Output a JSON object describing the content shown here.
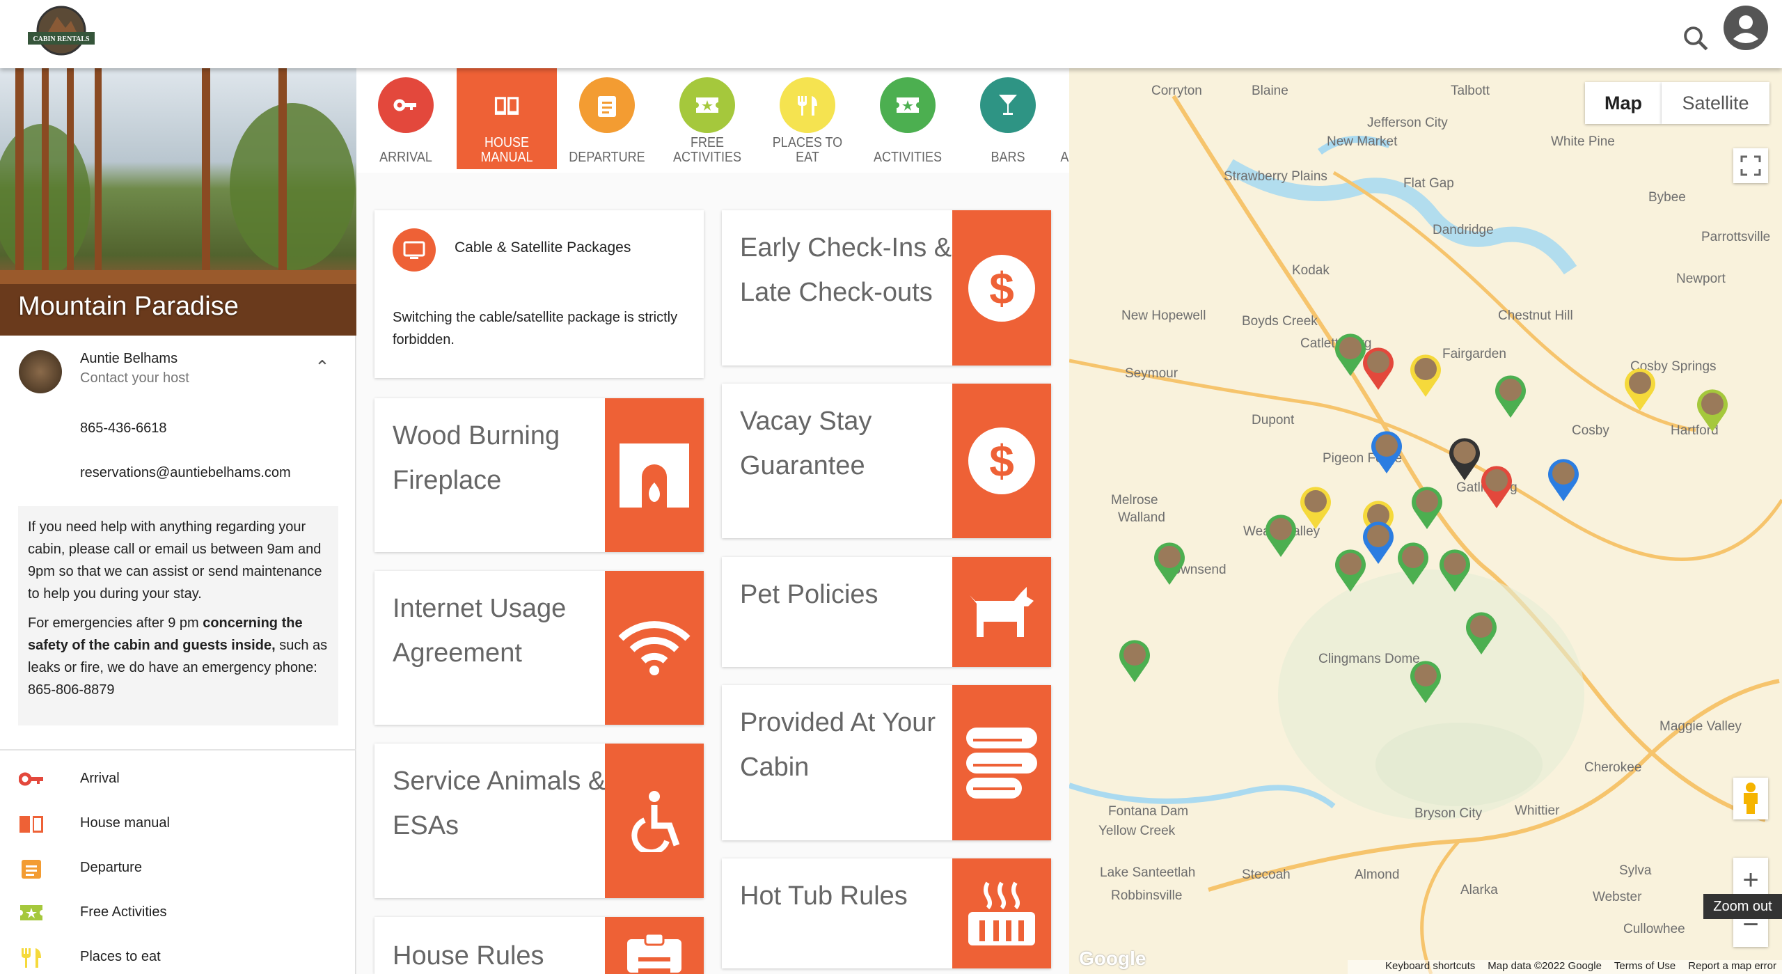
{
  "header": {
    "logo_text": "Auntie Belham's Cabin Rentals",
    "search_icon": "search-icon",
    "account_icon": "account-circle-icon"
  },
  "property": {
    "title": "Mountain Paradise"
  },
  "host": {
    "name": "Auntie Belhams",
    "subtitle": "Contact your host",
    "phone": "865-436-6618",
    "email": "reservations@auntiebelhams.com",
    "note_p1": "If you need help with anything regarding your cabin, please call or email us between 9am and 9pm so that we can assist or send maintenance to help you during your stay.",
    "note_p2_a": "For emergencies after 9 pm ",
    "note_p2_bold": "concerning the safety of the cabin and guests inside,",
    "note_p2_b": " such as leaks or fire, we do have an emergency phone: 865-806-8879"
  },
  "nav": [
    {
      "label": "Arrival",
      "color": "#e3483c"
    },
    {
      "label": "House manual",
      "color": "#ee6136"
    },
    {
      "label": "Departure",
      "color": "#f39c32"
    },
    {
      "label": "Free Activities",
      "color": "#a5c83c"
    },
    {
      "label": "Places to eat",
      "color": "#f5d93b"
    }
  ],
  "tabs": [
    {
      "label": "ARRIVAL",
      "color": "#e3483c",
      "icon": "key-icon"
    },
    {
      "label": "HOUSE MANUAL",
      "color": "#ee6136",
      "icon": "book-icon",
      "active": true
    },
    {
      "label": "DEPARTURE",
      "color": "#f39c32",
      "icon": "clipboard-icon"
    },
    {
      "label": "FREE ACTIVITIES",
      "color": "#a5c83c",
      "icon": "ticket-icon"
    },
    {
      "label": "PLACES TO EAT",
      "color": "#f5e350",
      "icon": "utensils-icon"
    },
    {
      "label": "ACTIVITIES",
      "color": "#4caf50",
      "icon": "ticket-icon"
    },
    {
      "label": "BARS",
      "color": "#2e9484",
      "icon": "cocktail-icon"
    },
    {
      "label": "A",
      "color": "#888888",
      "icon": ""
    }
  ],
  "cards": {
    "cable": {
      "title": "Cable & Satellite Packages",
      "body": "Switching the cable/satellite package is strictly forbidden.",
      "icon": "tv-icon"
    },
    "wood": {
      "title": "Wood Burning Fireplace",
      "icon": "fireplace-icon"
    },
    "internet": {
      "title": "Internet Usage Agreement",
      "icon": "wifi-icon"
    },
    "service": {
      "title": "Service Animals & ESAs",
      "icon": "accessible-icon"
    },
    "rules": {
      "title": "House Rules",
      "icon": "clipboard-icon"
    },
    "early": {
      "title": "Early Check-Ins & Late Check-outs",
      "icon": "dollar-icon"
    },
    "vacay": {
      "title": "Vacay Stay Guarantee",
      "icon": "dollar-icon"
    },
    "pet": {
      "title": "Pet Policies",
      "icon": "dog-icon"
    },
    "provided": {
      "title": "Provided At Your Cabin",
      "icon": "towels-icon"
    },
    "hottub": {
      "title": "Hot Tub Rules",
      "icon": "hot-tub-icon"
    }
  },
  "accent": "#ee6136",
  "map": {
    "type_buttons": [
      "Map",
      "Satellite"
    ],
    "selected_type": "Map",
    "tooltip": "Zoom out",
    "google": "Google",
    "footer": [
      "Keyboard shortcuts",
      "Map data ©2022 Google",
      "Terms of Use",
      "Report a map error"
    ],
    "places": [
      {
        "name": "Corryton"
      },
      {
        "name": "Blaine"
      },
      {
        "name": "Talbott"
      },
      {
        "name": "Jefferson City"
      },
      {
        "name": "New Market"
      },
      {
        "name": "White Pine"
      },
      {
        "name": "Strawberry Plains"
      },
      {
        "name": "Flat Gap"
      },
      {
        "name": "Bybee"
      },
      {
        "name": "Dandridge"
      },
      {
        "name": "Parrottsville"
      },
      {
        "name": "Kodak"
      },
      {
        "name": "Newport"
      },
      {
        "name": "New Hopewell"
      },
      {
        "name": "Boyds Creek"
      },
      {
        "name": "Chestnut Hill"
      },
      {
        "name": "Fairgarden"
      },
      {
        "name": "Seymour"
      },
      {
        "name": "Dupont"
      },
      {
        "name": "Cosby"
      },
      {
        "name": "Hartford"
      },
      {
        "name": "Pigeon Forge"
      },
      {
        "name": "Gatlinburg"
      },
      {
        "name": "Melrose"
      },
      {
        "name": "Walland"
      },
      {
        "name": "Wears Valley"
      },
      {
        "name": "Townsend"
      },
      {
        "name": "Clingmans Dome"
      },
      {
        "name": "Maggie Valley"
      },
      {
        "name": "Cherokee"
      },
      {
        "name": "Fontana Dam"
      },
      {
        "name": "Yellow Creek"
      },
      {
        "name": "Bryson City"
      },
      {
        "name": "Whittier"
      },
      {
        "name": "Lake Santeetlah"
      },
      {
        "name": "Stecoah"
      },
      {
        "name": "Almond"
      },
      {
        "name": "Alarka"
      },
      {
        "name": "Sylva"
      },
      {
        "name": "Webster"
      },
      {
        "name": "Robbinsville"
      },
      {
        "name": "Cullowhee"
      },
      {
        "name": "Catlettsburg"
      },
      {
        "name": "Cosby Springs"
      }
    ]
  }
}
